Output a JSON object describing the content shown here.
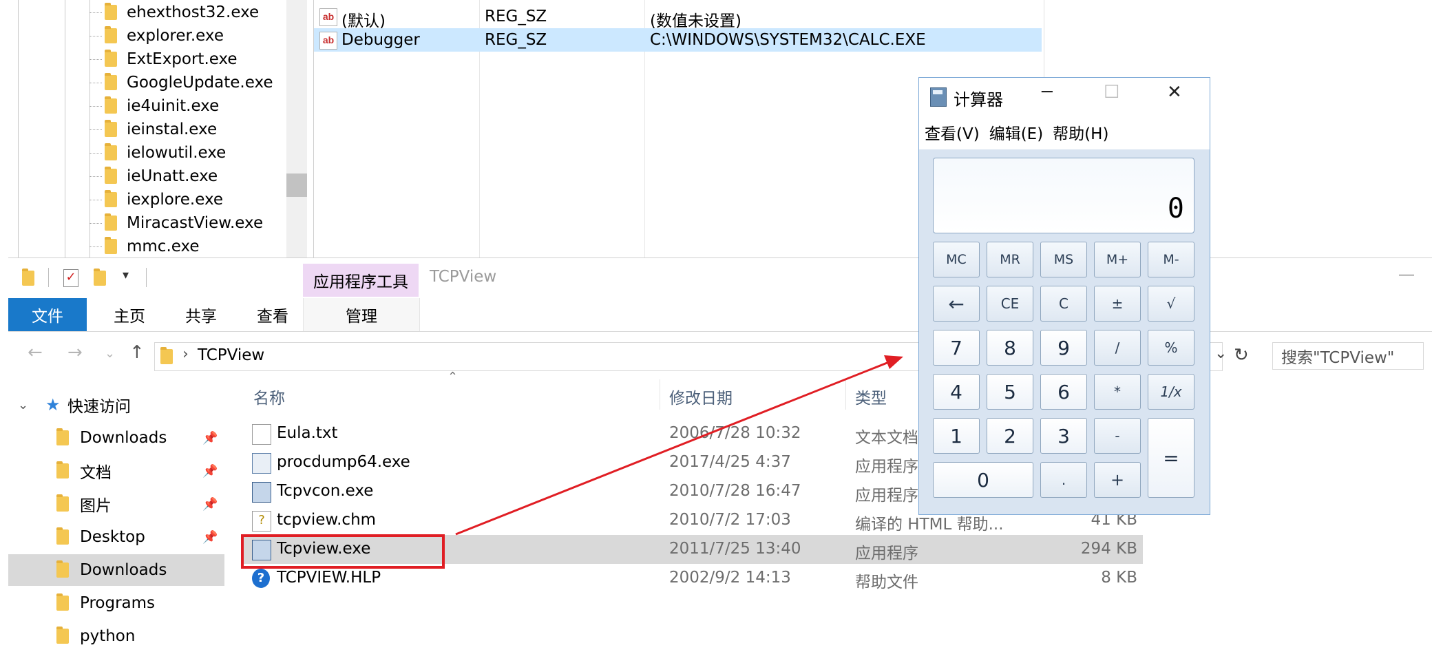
{
  "registry": {
    "tree_items": [
      "ehexthost32.exe",
      "explorer.exe",
      "ExtExport.exe",
      "GoogleUpdate.exe",
      "ie4uinit.exe",
      "ieinstal.exe",
      "ielowutil.exe",
      "ieUnatt.exe",
      "iexplore.exe",
      "MiracastView.exe",
      "mmc.exe"
    ],
    "values": [
      {
        "name": "(默认)",
        "type": "REG_SZ",
        "data": "(数值未设置)"
      },
      {
        "name": "Debugger",
        "type": "REG_SZ",
        "data": "C:\\WINDOWS\\SYSTEM32\\CALC.EXE"
      }
    ]
  },
  "explorer": {
    "context_tab": "应用程序工具",
    "window_title": "TCPView",
    "tabs": {
      "file": "文件",
      "home": "主页",
      "share": "共享",
      "view": "查看",
      "manage": "管理"
    },
    "address": {
      "path": "TCPView"
    },
    "search": {
      "placeholder": "搜索\"TCPView\""
    },
    "nav": {
      "quick_access": "快速访问",
      "items": [
        {
          "label": "Downloads",
          "pinned": true
        },
        {
          "label": "文档",
          "pinned": true
        },
        {
          "label": "图片",
          "pinned": true
        },
        {
          "label": "Desktop",
          "pinned": true
        },
        {
          "label": "Downloads",
          "pinned": false
        },
        {
          "label": "Programs",
          "pinned": false
        },
        {
          "label": "python",
          "pinned": false
        }
      ]
    },
    "columns": {
      "name": "名称",
      "date": "修改日期",
      "type": "类型"
    },
    "files": [
      {
        "name": "Eula.txt",
        "date": "2006/7/28 10:32",
        "type": "文本文档",
        "size": ""
      },
      {
        "name": "procdump64.exe",
        "date": "2017/4/25 4:37",
        "type": "应用程序",
        "size": ""
      },
      {
        "name": "Tcpvcon.exe",
        "date": "2010/7/28 16:47",
        "type": "应用程序",
        "size": ""
      },
      {
        "name": "tcpview.chm",
        "date": "2010/7/2 17:03",
        "type": "编译的 HTML 帮助...",
        "size": "41 KB"
      },
      {
        "name": "Tcpview.exe",
        "date": "2011/7/25 13:40",
        "type": "应用程序",
        "size": "294 KB"
      },
      {
        "name": "TCPVIEW.HLP",
        "date": "2002/9/2 14:13",
        "type": "帮助文件",
        "size": "8 KB"
      }
    ],
    "selected_index": 4
  },
  "calculator": {
    "title": "计算器",
    "menu": [
      "查看(V)",
      "编辑(E)",
      "帮助(H)"
    ],
    "display": "0",
    "memory": [
      "MC",
      "MR",
      "MS",
      "M+",
      "M-"
    ],
    "row2": [
      "←",
      "CE",
      "C",
      "±",
      "√"
    ],
    "row3": [
      "7",
      "8",
      "9",
      "/",
      "%"
    ],
    "row4": [
      "4",
      "5",
      "6",
      "*",
      "1/x"
    ],
    "row5": [
      "1",
      "2",
      "3",
      "-"
    ],
    "row6": [
      "0",
      ".",
      "+"
    ],
    "equals": "="
  },
  "colors": {
    "accent": "#1979ca",
    "context_tab": "#eed8f4",
    "highlight": "#e01e24",
    "selection": "#cce8ff"
  }
}
